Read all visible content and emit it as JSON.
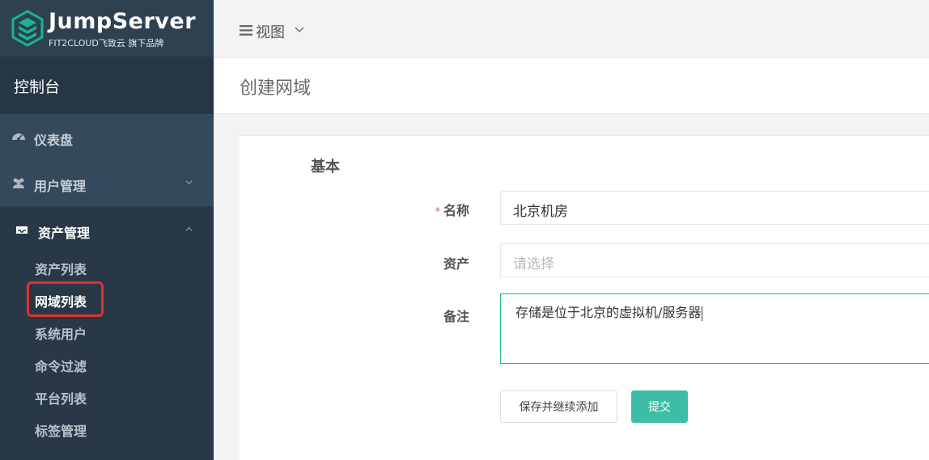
{
  "brand": {
    "title": "JumpServer",
    "subtitle": "FIT2CLOUD飞致云 旗下品牌",
    "accent": "#1ab394",
    "sidebar_bg": "#2f4050"
  },
  "sidebar": {
    "console_label": "控制台",
    "items": [
      {
        "label": "仪表盘",
        "icon": "dashboard-icon"
      },
      {
        "label": "用户管理",
        "icon": "users-icon",
        "expanded": false
      },
      {
        "label": "资产管理",
        "icon": "inbox-icon",
        "expanded": true
      }
    ],
    "asset_sub_items": [
      {
        "label": "资产列表"
      },
      {
        "label": "网域列表",
        "active": true
      },
      {
        "label": "系统用户"
      },
      {
        "label": "命令过滤"
      },
      {
        "label": "平台列表"
      },
      {
        "label": "标签管理"
      }
    ]
  },
  "topbar": {
    "view_label": "视图"
  },
  "page": {
    "title": "创建网域"
  },
  "form": {
    "section_title": "基本",
    "name_label": "名称",
    "name_value": "北京机房",
    "assets_label": "资产",
    "assets_placeholder": "请选择",
    "comment_label": "备注",
    "comment_value": "存储是位于北京的虚拟机/服务器",
    "save_continue_label": "保存并继续添加",
    "submit_label": "提交"
  }
}
